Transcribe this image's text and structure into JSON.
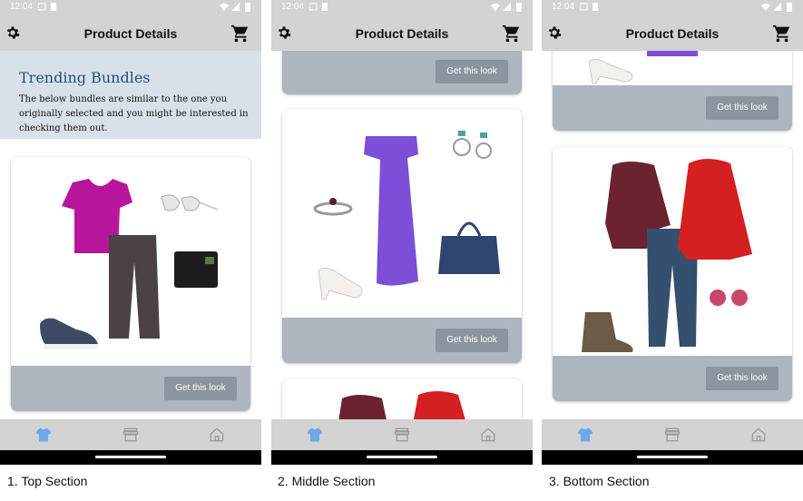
{
  "screens": [
    {
      "status": {
        "time": "12:04"
      },
      "appbar": {
        "title": "Product Details"
      },
      "banner": {
        "title": "Trending Bundles",
        "description": "The below bundles are similar to the one you originally selected and you might be interested in checking them out."
      },
      "button_label": "Get this look",
      "caption": "1. Top Section"
    },
    {
      "status": {
        "time": "12:04"
      },
      "appbar": {
        "title": "Product Details"
      },
      "button_label": "Get this look",
      "caption": "2. Middle Section"
    },
    {
      "status": {
        "time": "12:04"
      },
      "appbar": {
        "title": "Product Details"
      },
      "button_label": "Get this look",
      "caption": "3. Bottom Section"
    }
  ],
  "bottom_nav": {
    "icons": [
      "shirt-icon",
      "store-icon",
      "home-icon"
    ],
    "active_color": "#6fa8e8"
  },
  "colors": {
    "appbar": "#d3d3d3",
    "banner": "#d8e1ea",
    "card_footer": "#adb5bf",
    "button": "#8b959f"
  }
}
